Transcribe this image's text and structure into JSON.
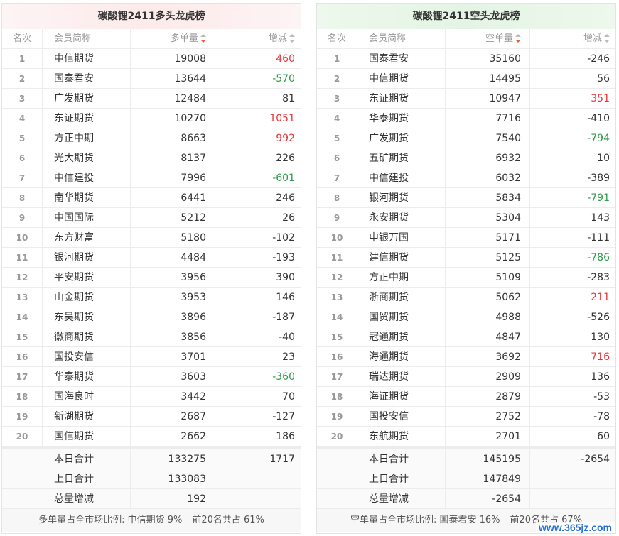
{
  "left": {
    "title": "碳酸锂2411多头龙虎榜",
    "headers": {
      "rank": "名次",
      "member": "会员简称",
      "volume": "多单量",
      "change": "增减"
    },
    "rows": [
      {
        "rank": "1",
        "name": "中信期货",
        "vol": "19008",
        "chg": "460",
        "dir": "up"
      },
      {
        "rank": "2",
        "name": "国泰君安",
        "vol": "13644",
        "chg": "-570",
        "dir": "down"
      },
      {
        "rank": "3",
        "name": "广发期货",
        "vol": "12484",
        "chg": "81",
        "dir": "none"
      },
      {
        "rank": "4",
        "name": "东证期货",
        "vol": "10270",
        "chg": "1051",
        "dir": "up"
      },
      {
        "rank": "5",
        "name": "方正中期",
        "vol": "8663",
        "chg": "992",
        "dir": "up"
      },
      {
        "rank": "6",
        "name": "光大期货",
        "vol": "8137",
        "chg": "226",
        "dir": "none"
      },
      {
        "rank": "7",
        "name": "中信建投",
        "vol": "7996",
        "chg": "-601",
        "dir": "down"
      },
      {
        "rank": "8",
        "name": "南华期货",
        "vol": "6441",
        "chg": "246",
        "dir": "none"
      },
      {
        "rank": "9",
        "name": "中国国际",
        "vol": "5212",
        "chg": "26",
        "dir": "none"
      },
      {
        "rank": "10",
        "name": "东方财富",
        "vol": "5180",
        "chg": "-102",
        "dir": "none"
      },
      {
        "rank": "11",
        "name": "银河期货",
        "vol": "4484",
        "chg": "-193",
        "dir": "none"
      },
      {
        "rank": "12",
        "name": "平安期货",
        "vol": "3956",
        "chg": "390",
        "dir": "none"
      },
      {
        "rank": "13",
        "name": "山金期货",
        "vol": "3953",
        "chg": "146",
        "dir": "none"
      },
      {
        "rank": "14",
        "name": "东吴期货",
        "vol": "3896",
        "chg": "-187",
        "dir": "none"
      },
      {
        "rank": "15",
        "name": "徽商期货",
        "vol": "3856",
        "chg": "-40",
        "dir": "none"
      },
      {
        "rank": "16",
        "name": "国投安信",
        "vol": "3701",
        "chg": "23",
        "dir": "none"
      },
      {
        "rank": "17",
        "name": "华泰期货",
        "vol": "3603",
        "chg": "-360",
        "dir": "down"
      },
      {
        "rank": "18",
        "name": "国海良时",
        "vol": "3442",
        "chg": "70",
        "dir": "none"
      },
      {
        "rank": "19",
        "name": "新湖期货",
        "vol": "2687",
        "chg": "-127",
        "dir": "none"
      },
      {
        "rank": "20",
        "name": "国信期货",
        "vol": "2662",
        "chg": "186",
        "dir": "none"
      }
    ],
    "summary": [
      {
        "label": "本日合计",
        "vol": "133275",
        "chg": "1717"
      },
      {
        "label": "上日合计",
        "vol": "133083",
        "chg": ""
      },
      {
        "label": "总量增减",
        "vol": "192",
        "chg": ""
      }
    ],
    "footer": {
      "ratio": "多单量占全市场比例: 中信期货 9%",
      "top20": "前20名共占 61%"
    }
  },
  "right": {
    "title": "碳酸锂2411空头龙虎榜",
    "headers": {
      "rank": "名次",
      "member": "会员简称",
      "volume": "空单量",
      "change": "增减"
    },
    "rows": [
      {
        "rank": "1",
        "name": "国泰君安",
        "vol": "35160",
        "chg": "-246",
        "dir": "none"
      },
      {
        "rank": "2",
        "name": "中信期货",
        "vol": "14495",
        "chg": "56",
        "dir": "none"
      },
      {
        "rank": "3",
        "name": "东证期货",
        "vol": "10947",
        "chg": "351",
        "dir": "up"
      },
      {
        "rank": "4",
        "name": "华泰期货",
        "vol": "7716",
        "chg": "-410",
        "dir": "none"
      },
      {
        "rank": "5",
        "name": "广发期货",
        "vol": "7540",
        "chg": "-794",
        "dir": "down"
      },
      {
        "rank": "6",
        "name": "五矿期货",
        "vol": "6932",
        "chg": "10",
        "dir": "none"
      },
      {
        "rank": "7",
        "name": "中信建投",
        "vol": "6032",
        "chg": "-389",
        "dir": "none"
      },
      {
        "rank": "8",
        "name": "银河期货",
        "vol": "5834",
        "chg": "-791",
        "dir": "down"
      },
      {
        "rank": "9",
        "name": "永安期货",
        "vol": "5304",
        "chg": "143",
        "dir": "none"
      },
      {
        "rank": "10",
        "name": "申银万国",
        "vol": "5171",
        "chg": "-111",
        "dir": "none"
      },
      {
        "rank": "11",
        "name": "建信期货",
        "vol": "5125",
        "chg": "-786",
        "dir": "down"
      },
      {
        "rank": "12",
        "name": "方正中期",
        "vol": "5109",
        "chg": "-283",
        "dir": "none"
      },
      {
        "rank": "13",
        "name": "浙商期货",
        "vol": "5062",
        "chg": "211",
        "dir": "up"
      },
      {
        "rank": "14",
        "name": "国贸期货",
        "vol": "4988",
        "chg": "-526",
        "dir": "none"
      },
      {
        "rank": "15",
        "name": "冠通期货",
        "vol": "4847",
        "chg": "130",
        "dir": "none"
      },
      {
        "rank": "16",
        "name": "海通期货",
        "vol": "3692",
        "chg": "716",
        "dir": "up"
      },
      {
        "rank": "17",
        "name": "瑞达期货",
        "vol": "2909",
        "chg": "136",
        "dir": "none"
      },
      {
        "rank": "18",
        "name": "海证期货",
        "vol": "2879",
        "chg": "-53",
        "dir": "none"
      },
      {
        "rank": "19",
        "name": "国投安信",
        "vol": "2752",
        "chg": "-78",
        "dir": "none"
      },
      {
        "rank": "20",
        "name": "东航期货",
        "vol": "2701",
        "chg": "60",
        "dir": "none"
      }
    ],
    "summary": [
      {
        "label": "本日合计",
        "vol": "145195",
        "chg": "-2654"
      },
      {
        "label": "上日合计",
        "vol": "147849",
        "chg": ""
      },
      {
        "label": "总量增减",
        "vol": "-2654",
        "chg": ""
      }
    ],
    "footer": {
      "ratio": "空单量占全市场比例: 国泰君安 16%",
      "top20": "前20名共占 67%"
    }
  },
  "colors": {
    "up": "#e8353b",
    "down": "#2f9a4a",
    "sort_active": "#e8613c"
  },
  "icons": {
    "sort": "sort-arrows-icon",
    "sort_active": "sort-desc-active-icon"
  },
  "watermark": "www.365jz.com"
}
